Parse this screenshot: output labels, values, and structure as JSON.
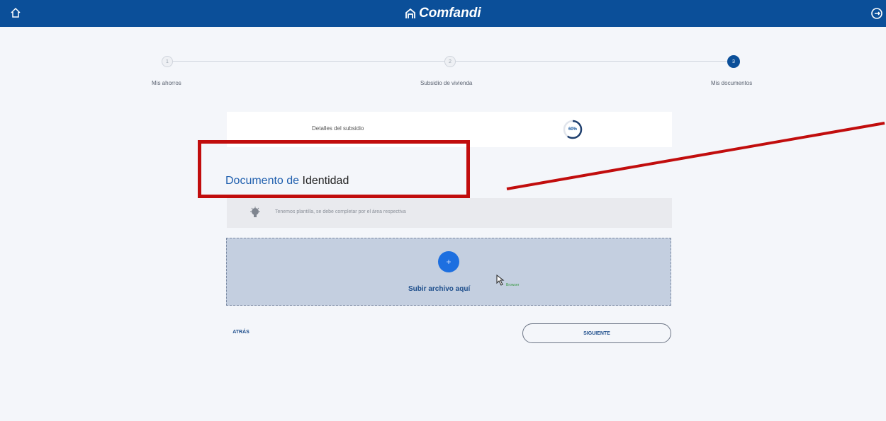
{
  "header": {
    "brand": "Comfandi"
  },
  "stepper": {
    "steps": [
      {
        "label": "Mis ahorros",
        "number": "1"
      },
      {
        "label": "Subsidio de vivienda",
        "number": "2"
      },
      {
        "label": "Mis documentos",
        "number": "3",
        "active": true
      }
    ]
  },
  "detail_card": {
    "label": "Detalles del subsidio",
    "progress": "60%"
  },
  "section": {
    "title_part1": "Documento de",
    "title_part2": "Identidad"
  },
  "hint": {
    "text": "Tenemos plantilla, se debe completar por el área respectiva"
  },
  "upload": {
    "label": "Subir archivo aquí",
    "cursor_tag": "Browser"
  },
  "actions": {
    "back_label": "ATRÁS",
    "next_label": "SIGUIENTE"
  },
  "colors": {
    "header_bg": "#0b4f99",
    "accent": "#1d6fe0",
    "annotation": "#c10d0d"
  }
}
